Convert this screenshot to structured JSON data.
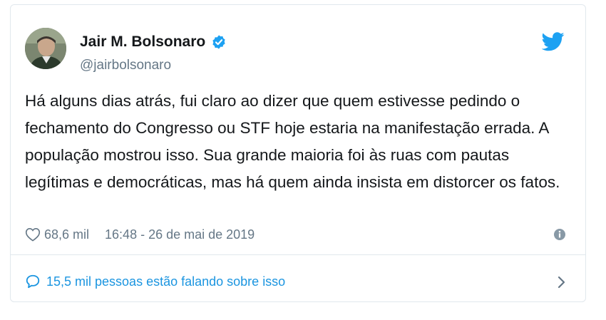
{
  "author": {
    "name": "Jair M. Bolsonaro",
    "handle": "@jairbolsonaro",
    "verified": true
  },
  "tweet": {
    "text": "Há alguns dias atrás, fui claro ao dizer que quem estivesse pedindo o fechamento do Congresso ou STF hoje estaria na manifestação errada. A população mostrou isso. Sua grande maioria foi às ruas com pautas legítimas e democráticas, mas há quem ainda insista em distorcer os fatos.",
    "likes": "68,6 mil",
    "timestamp": "16:48 - 26 de mai de 2019"
  },
  "conversation": {
    "label": "15,5 mil pessoas estão falando sobre isso"
  },
  "icons": {
    "verified": "verified-badge-icon",
    "brand": "twitter-bird-icon",
    "like": "heart-icon",
    "info": "info-icon",
    "reply": "speech-bubble-icon",
    "more": "chevron-right-icon"
  },
  "colors": {
    "brand_blue": "#1da1f2",
    "link_blue": "#1b95e0",
    "text": "#14171a",
    "secondary": "#657786",
    "border": "#e1e8ed"
  }
}
